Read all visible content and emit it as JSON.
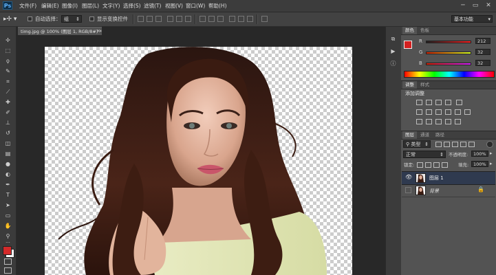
{
  "app": {
    "logo": "Ps"
  },
  "menu": [
    "文件(F)",
    "编辑(E)",
    "图像(I)",
    "图层(L)",
    "文字(Y)",
    "选择(S)",
    "滤镜(T)",
    "视图(V)",
    "窗口(W)",
    "帮助(H)"
  ],
  "window_controls": {
    "minimize": "─",
    "restore": "▭",
    "close": "✕"
  },
  "options": {
    "auto_select_label": "自动选择：",
    "auto_select_value": "组",
    "show_transform_label": "显示变换控件",
    "workspace": "基本功能"
  },
  "document": {
    "tab_title": "timg.jpg @ 100% (图层 1, RGB/8#) *",
    "close": "×"
  },
  "tools": [
    "move",
    "marquee",
    "lasso",
    "quick-select",
    "crop",
    "eyedropper",
    "healing",
    "brush",
    "stamp",
    "history-brush",
    "eraser",
    "gradient",
    "blur",
    "dodge",
    "pen",
    "type",
    "path-select",
    "shape",
    "hand",
    "zoom"
  ],
  "colors": {
    "foreground": "#d42a2a",
    "background": "#ffffff",
    "current_color": "#d42020"
  },
  "color_panel": {
    "tabs": [
      "颜色",
      "色板"
    ],
    "rows": [
      {
        "label": "R",
        "value": "212"
      },
      {
        "label": "G",
        "value": "32"
      },
      {
        "label": "B",
        "value": "32"
      }
    ]
  },
  "adjust_panel": {
    "tabs": [
      "调整",
      "样式"
    ],
    "title": "添加调整"
  },
  "layers_panel": {
    "tabs": [
      "图层",
      "通道",
      "路径"
    ],
    "filter_type": "类型",
    "blend_mode": "正常",
    "opacity_label": "不透明度:",
    "opacity_value": "100%",
    "lock_label": "锁定:",
    "fill_label": "填充:",
    "fill_value": "100%",
    "layers": [
      {
        "name": "图层 1",
        "visible": true,
        "selected": true,
        "locked": false
      },
      {
        "name": "背景",
        "visible": false,
        "selected": false,
        "locked": true
      }
    ]
  }
}
